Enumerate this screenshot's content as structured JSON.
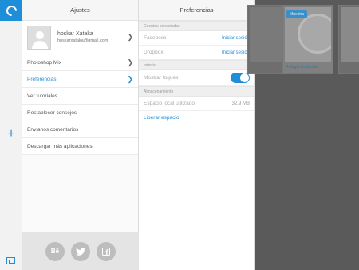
{
  "settings": {
    "title": "Ajustes",
    "profile": {
      "name": "hoskar Xataka",
      "email": "hoskarxataka@gmail.com"
    },
    "items": [
      {
        "label": "Photoshop Mix"
      },
      {
        "label": "Preferencias"
      },
      {
        "label": "Ver tutoriales"
      },
      {
        "label": "Restablecer consejos"
      },
      {
        "label": "Envíanos comentarios"
      },
      {
        "label": "Descargar más aplicaciones"
      }
    ],
    "social": {
      "behance_label": "Bē"
    }
  },
  "preferences": {
    "title": "Preferencias",
    "connected_section": "Cuentas conectadas",
    "facebook_label": "Facebook",
    "facebook_action": "Iniciar sesión",
    "dropbox_label": "Dropbox",
    "dropbox_action": "Iniciar sesión",
    "interface_section": "Interfaz",
    "show_touches_label": "Mostrar toques",
    "show_touches_on": true,
    "storage_section": "Almacenamiento",
    "local_space_label": "Espacio local utilizado",
    "local_space_value": "32,9 MB",
    "free_space_label": "Liberar espacio"
  },
  "library": {
    "badge": "Muestra",
    "caption": "Refugio en el cielo"
  },
  "colors": {
    "accent": "#1f8ed8"
  }
}
